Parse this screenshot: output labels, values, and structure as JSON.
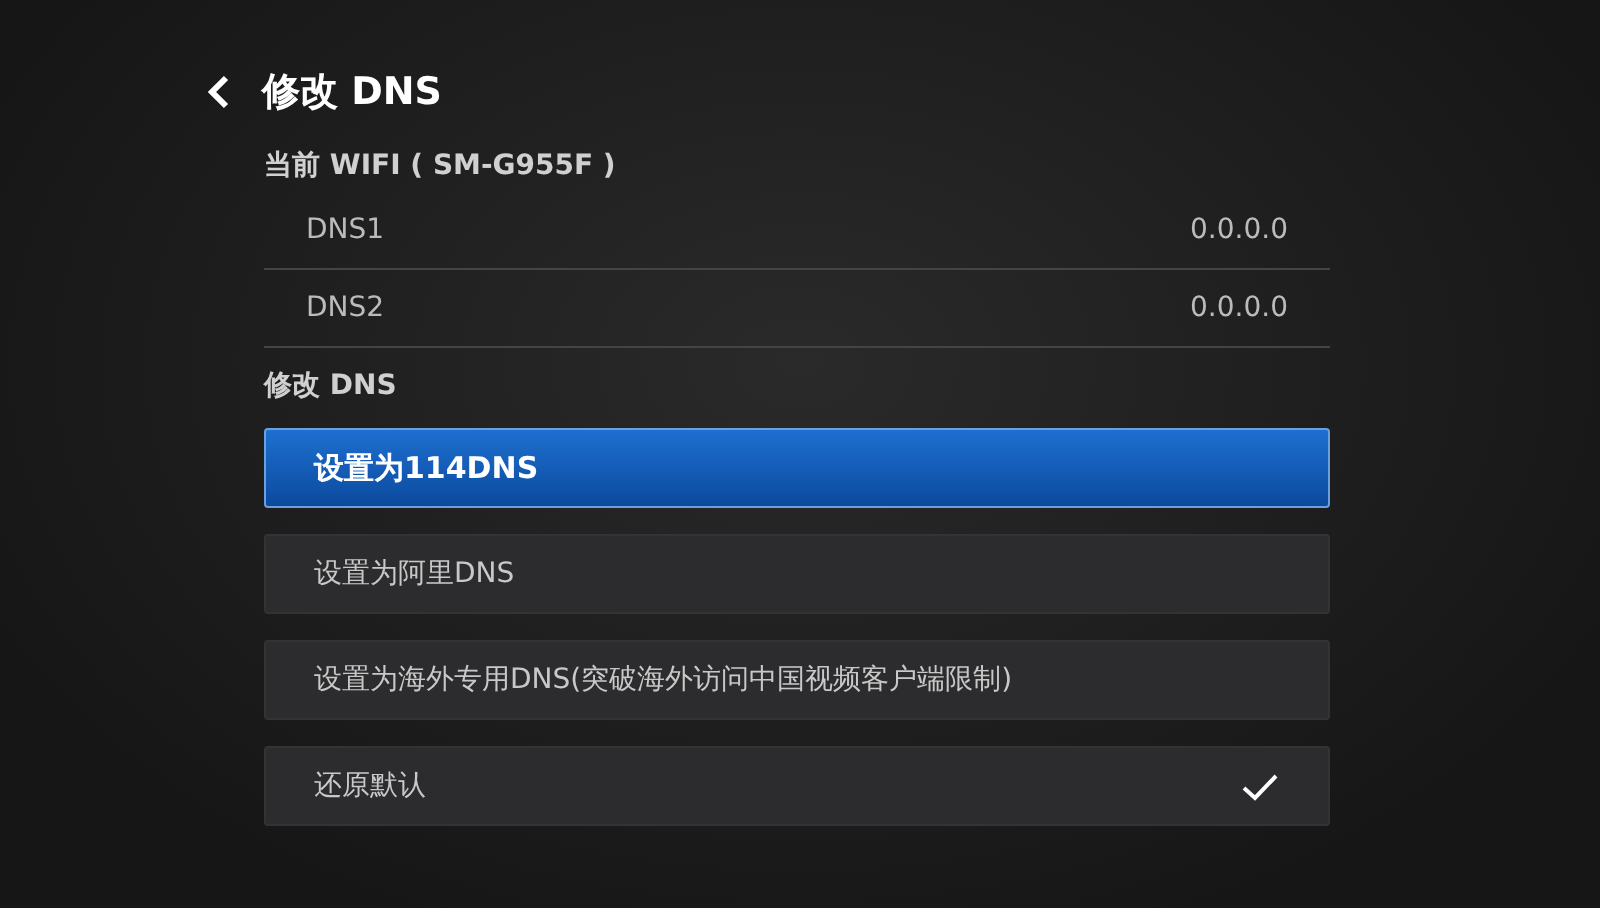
{
  "header": {
    "title": "修改 DNS"
  },
  "current_wifi": {
    "label": "当前 WIFI ( SM-G955F )",
    "entries": [
      {
        "name": "DNS1",
        "value": "0.0.0.0"
      },
      {
        "name": "DNS2",
        "value": "0.0.0.0"
      }
    ]
  },
  "modify_section": {
    "label": "修改 DNS",
    "options": [
      {
        "label": "设置为114DNS",
        "selected": true,
        "checked": false
      },
      {
        "label": "设置为阿里DNS",
        "selected": false,
        "checked": false
      },
      {
        "label": "设置为海外专用DNS(突破海外访问中国视频客户端限制)",
        "selected": false,
        "checked": false
      },
      {
        "label": "还原默认",
        "selected": false,
        "checked": true
      }
    ]
  }
}
